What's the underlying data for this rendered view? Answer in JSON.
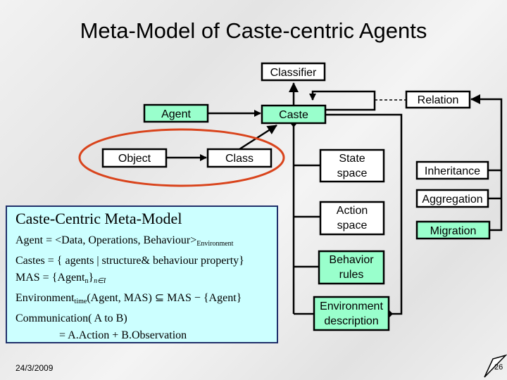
{
  "title": "Meta-Model of Caste-centric Agents",
  "nodes": {
    "classifier": "Classifier",
    "relation": "Relation",
    "agent": "Agent",
    "caste": "Caste",
    "object": "Object",
    "class": "Class",
    "state_space": [
      "State",
      "space"
    ],
    "action_space": [
      "Action",
      "space"
    ],
    "behavior_rules": [
      "Behavior",
      "rules"
    ],
    "environment_description": [
      "Environment",
      "description"
    ],
    "inheritance": "Inheritance",
    "aggregation": "Aggregation",
    "migration": "Migration"
  },
  "colors": {
    "highlight_fill": "#99ffcc",
    "ellipse": "#d9441c",
    "model_box": "#ccffff",
    "model_border": "#1f2f6a"
  },
  "model": {
    "heading": "Caste-Centric Meta-Model",
    "agent_line": "Agent = <Data, Operations, Behaviour>",
    "agent_sub": "Environment",
    "castes_line": "Castes = { agents | structure& behaviour property}",
    "mas_a": "MAS = {Agent",
    "mas_n": "n",
    "mas_b": "}",
    "mas_sub": "n∈I",
    "env_a": "Environment",
    "env_sub": "time",
    "env_b": "(Agent, MAS) ⊆ MAS − {Agent}",
    "comm_line": "Communication( A to B)",
    "comm_line2": "= A.Action + B.Observation"
  },
  "footer": {
    "date": "24/3/2009",
    "page": "26"
  }
}
